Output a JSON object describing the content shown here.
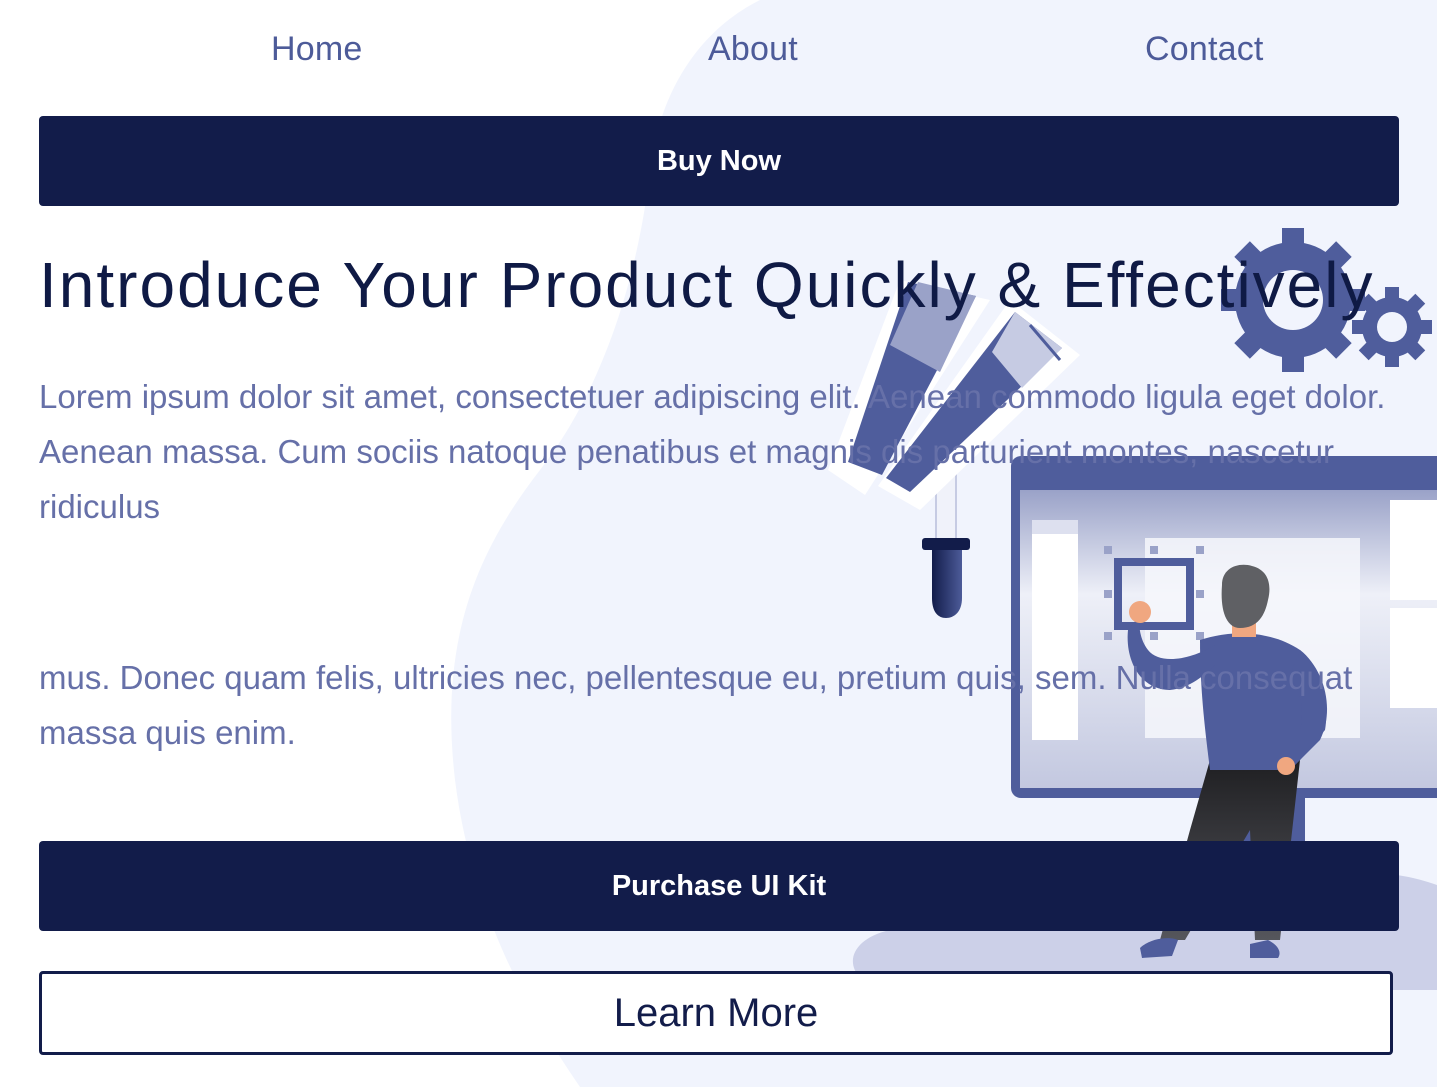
{
  "nav": {
    "items": [
      {
        "label": "Home"
      },
      {
        "label": "About"
      },
      {
        "label": "Contact"
      }
    ]
  },
  "buy_button": {
    "label": "Buy Now"
  },
  "hero": {
    "title": "Introduce Your Product Quickly & Effectively",
    "paragraph_1": "Lorem ipsum dolor sit amet, consectetuer adipiscing elit. Aenean commodo ligula eget dolor. Aenean massa. Cum sociis natoque penatibus et magnis dis parturient montes, nascetur ridiculus",
    "paragraph_2": "mus. Donec quam felis, ultricies nec, pellentesque eu, pretium quis, sem. Nulla consequat massa quis enim."
  },
  "purchase_button": {
    "label": "Purchase UI Kit"
  },
  "learn_more_button": {
    "label": "Learn More"
  },
  "colors": {
    "nav_text": "#4d5b99",
    "primary_button": "#121c4a",
    "headline": "#0f1a45",
    "body_text": "#6670a8",
    "blob_background": "#f1f4fd",
    "illustration_accent": "#4f5d9c"
  },
  "illustration": {
    "icons": [
      "gear-icon",
      "color-swatch-icon",
      "dropper-icon",
      "monitor-icon",
      "person-figure"
    ]
  }
}
